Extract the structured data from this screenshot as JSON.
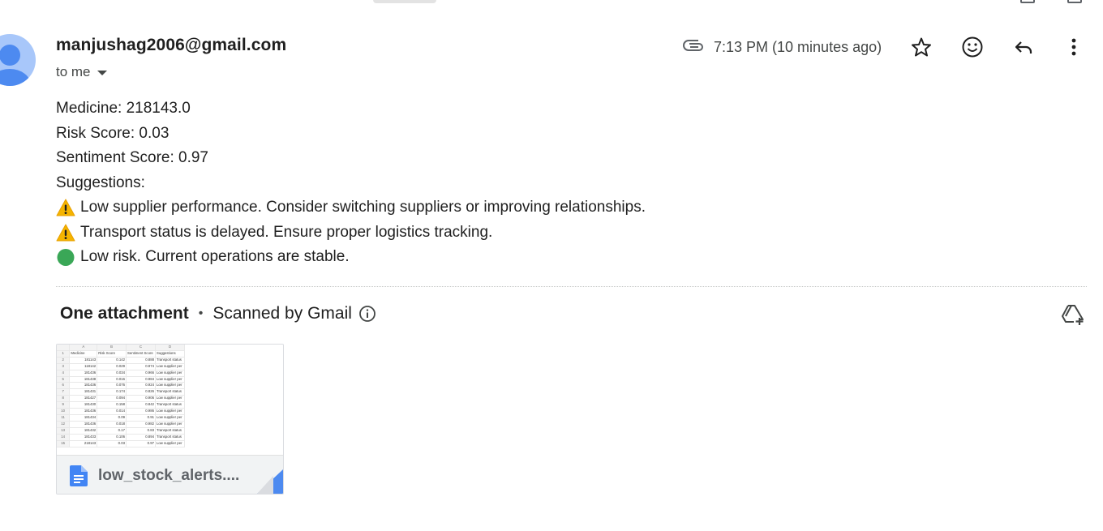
{
  "email": {
    "sender": "manjushag2006@gmail.com",
    "to_label": "to me",
    "time": "7:13 PM (10 minutes ago)",
    "body_lines": [
      {
        "emoji": "",
        "text": "Medicine: 218143.0"
      },
      {
        "emoji": "",
        "text": "Risk Score: 0.03"
      },
      {
        "emoji": "",
        "text": "Sentiment Score: 0.97"
      },
      {
        "emoji": "",
        "text": "Suggestions:"
      },
      {
        "emoji": "warning-sign",
        "text": "Low supplier performance. Consider switching suppliers or improving relationships."
      },
      {
        "emoji": "warning-sign",
        "text": "Transport status is delayed. Ensure proper logistics tracking."
      },
      {
        "emoji": "green-circle",
        "text": "Low risk. Current operations are stable."
      }
    ]
  },
  "attachments": {
    "title": "One attachment",
    "separator": "•",
    "scanned": "Scanned by Gmail",
    "file": {
      "name": "low_stock_alerts....",
      "icon": "google-docs-icon",
      "preview": {
        "column_letters": [
          "A",
          "B",
          "C",
          "D"
        ],
        "headers": [
          "Medicine",
          "Risk Score",
          "Sentiment Score",
          "Suggestions"
        ],
        "rows": [
          [
            "2",
            "181143",
            "0.142",
            "0.888",
            "Transport status"
          ],
          [
            "3",
            "118142",
            "0.029",
            "0.974",
            "Low supplier per"
          ],
          [
            "4",
            "181436",
            "0.034",
            "0.966",
            "Low supplier per"
          ],
          [
            "5",
            "181438",
            "0.016",
            "0.984",
            "Low supplier per"
          ],
          [
            "6",
            "181436",
            "0.076",
            "0.924",
            "Low supplier per"
          ],
          [
            "7",
            "181431",
            "0.174",
            "0.826",
            "Transport status"
          ],
          [
            "8",
            "181427",
            "0.094",
            "0.906",
            "Low supplier per"
          ],
          [
            "9",
            "181430",
            "0.158",
            "0.842",
            "Transport status"
          ],
          [
            "10",
            "181436",
            "0.014",
            "0.986",
            "Low supplier per"
          ],
          [
            "11",
            "181434",
            "0.09",
            "0.91",
            "Low supplier per"
          ],
          [
            "12",
            "181436",
            "0.018",
            "0.982",
            "Low supplier per"
          ],
          [
            "13",
            "181432",
            "0.17",
            "0.83",
            "Transport status"
          ],
          [
            "14",
            "181433",
            "0.106",
            "0.894",
            "Transport status"
          ],
          [
            "15",
            "218143",
            "0.03",
            "0.97",
            "Low supplier per"
          ]
        ]
      }
    }
  },
  "icons": {
    "attachment": "paperclip-icon",
    "star": "star-icon",
    "emoji": "smiley-icon",
    "reply": "reply-icon",
    "more": "more-vert-icon",
    "info": "info-icon",
    "drive": "add-to-drive-icon"
  },
  "colors": {
    "accent_blue": "#4d8af0",
    "avatar_bg": "#a8c7fa",
    "text_primary": "#1f1f1f",
    "text_secondary": "#444746",
    "warning": "#f5b400",
    "green": "#3aa757"
  }
}
